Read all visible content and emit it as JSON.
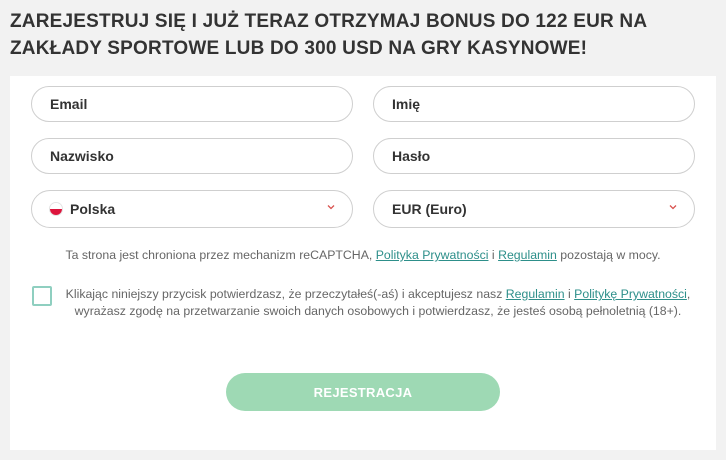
{
  "header": {
    "title": "ZAREJESTRUJ SIĘ I JUŻ TERAZ OTRZYMAJ BONUS DO 122 EUR NA ZAKŁADY SPORTOWE LUB DO 300 USD NA GRY KASYNOWE!"
  },
  "form": {
    "email_placeholder": "Email",
    "first_name_placeholder": "Imię",
    "last_name_placeholder": "Nazwisko",
    "password_placeholder": "Hasło",
    "country_value": "Polska",
    "currency_value": "EUR (Euro)",
    "recaptcha": {
      "prefix": "Ta strona jest chroniona przez mechanizm reCAPTCHA, ",
      "privacy_link": "Polityka Prywatności",
      "and": " i ",
      "terms_link": "Regulamin",
      "suffix": " pozostają w mocy."
    },
    "consent": {
      "prefix": "Klikając niniejszy przycisk potwierdzasz, że przeczytałeś(-aś) i akceptujesz nasz ",
      "terms_link": "Regulamin",
      "and": " i ",
      "privacy_link": "Politykę Prywatności",
      "suffix": ", wyrażasz zgodę na przetwarzanie swoich danych osobowych i potwierdzasz, że jesteś osobą pełnoletnią (18+)."
    },
    "checkbox_checked": false,
    "submit_label": "REJESTRACJA"
  },
  "colors": {
    "accent_link": "#2d8f8a",
    "button_bg": "#9ed9b4",
    "flag_red": "#dc143c"
  },
  "icons": {
    "select_arrow": "chevron-down-icon",
    "country_flag": "poland-flag-icon"
  }
}
